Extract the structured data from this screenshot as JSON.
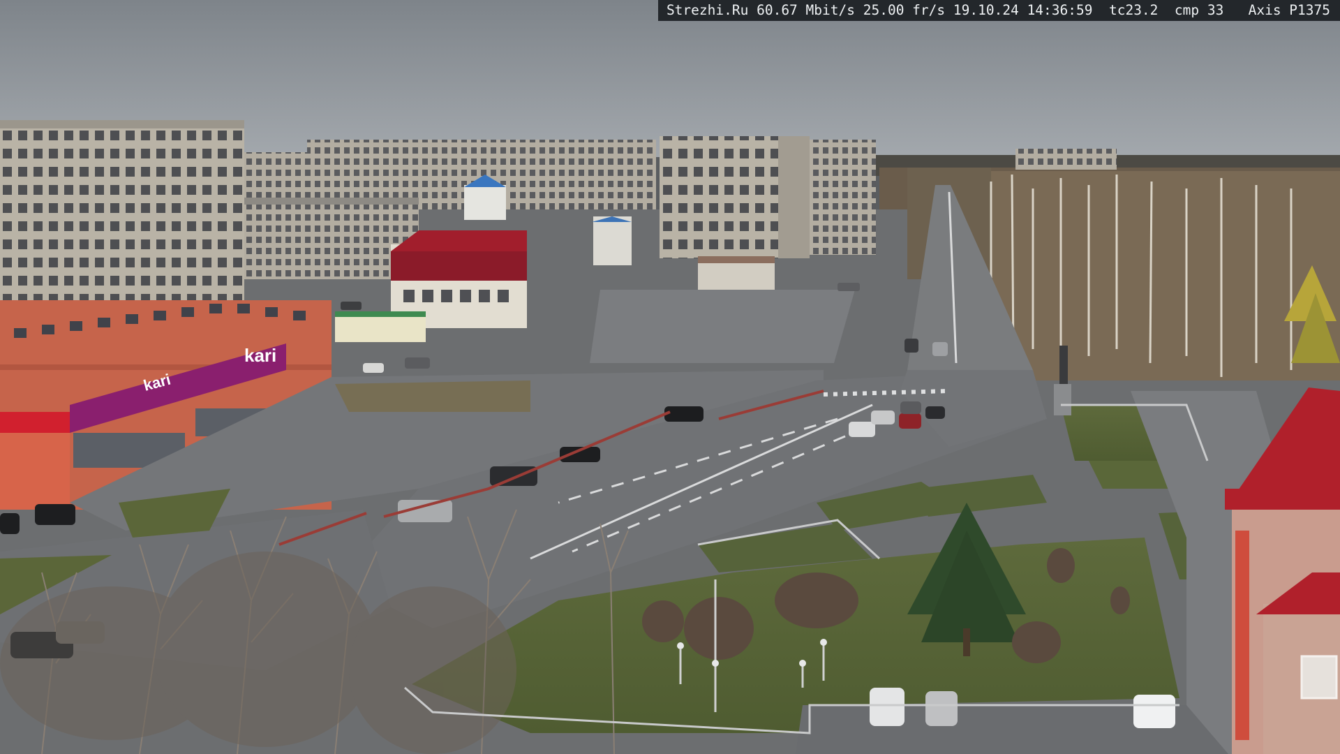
{
  "overlay": {
    "site": "Strezhi.Ru",
    "bitrate": "60.67 Mbit/s",
    "framerate": "25.00 fr/s",
    "date": "19.10.24",
    "time": "14:36:59",
    "tc": "tc23.2",
    "cmp": "cmp 33",
    "camera": "Axis P1375"
  },
  "signs": {
    "store_brand": "kari",
    "store_slogan": "kari"
  },
  "colors": {
    "sky": "#8a9096",
    "road": "#6f7275",
    "grass": "#5d6b3a",
    "store_facade": "#c8634a",
    "store_banner": "#8a1f6e",
    "roof_red": "#b01c2a"
  }
}
